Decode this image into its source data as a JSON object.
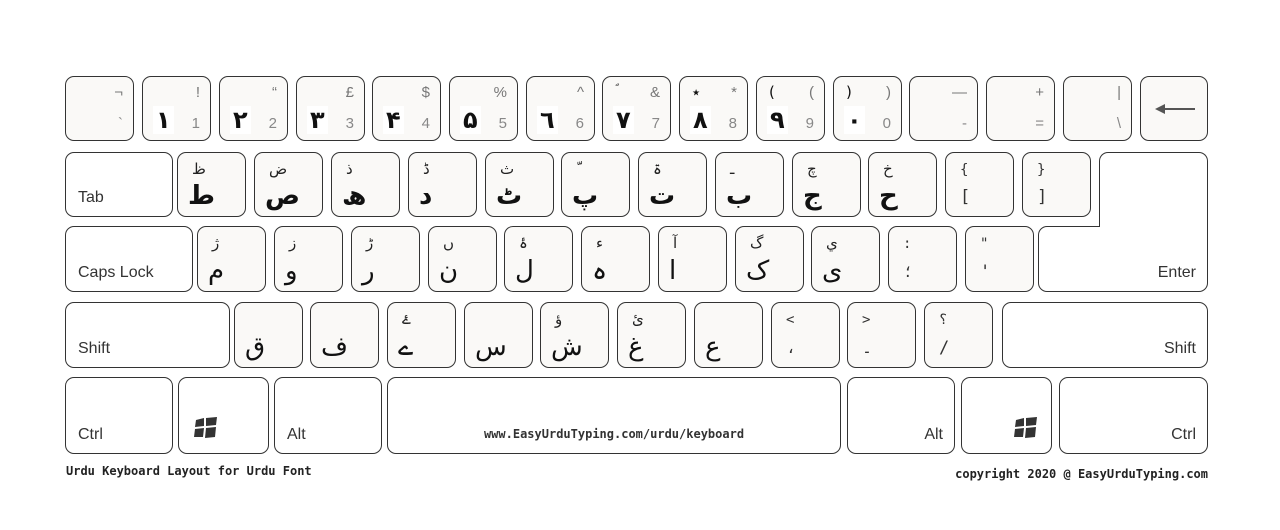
{
  "number_row": [
    {
      "shift": "¬",
      "en": "`",
      "ur": ""
    },
    {
      "shift": "!",
      "en": "1",
      "ur": "۱"
    },
    {
      "shift": "“",
      "en": "2",
      "ur": "۲"
    },
    {
      "shift": "£",
      "en": "3",
      "ur": "۳"
    },
    {
      "shift": "$",
      "en": "4",
      "ur": "۴"
    },
    {
      "shift": "%",
      "en": "5",
      "ur": "۵"
    },
    {
      "shift": "^",
      "en": "6",
      "ur": "٦"
    },
    {
      "shift": "&",
      "en": "7",
      "ur": "۷",
      "ur_shift": "ؐ"
    },
    {
      "shift": "*",
      "en": "8",
      "ur": "۸",
      "ur_shift": "٭"
    },
    {
      "shift": "(",
      "en": "9",
      "ur": "۹",
      "ur_shift": "("
    },
    {
      "shift": ")",
      "en": "0",
      "ur": "۰",
      "ur_shift": ")"
    },
    {
      "shift": "—",
      "en": "-",
      "ur": ""
    },
    {
      "shift": "+",
      "en": "=",
      "ur": ""
    },
    {
      "shift": "|",
      "en": "\\",
      "ur": ""
    }
  ],
  "backspace": {
    "icon": "backspace-arrow-icon"
  },
  "tab": {
    "label": "Tab"
  },
  "top_row": [
    {
      "top": "ظ",
      "main": "ط"
    },
    {
      "top": "ض",
      "main": "ص"
    },
    {
      "top": "ذ",
      "main": "ھ"
    },
    {
      "top": "ڈ",
      "main": "د"
    },
    {
      "top": "ث",
      "main": "ٹ"
    },
    {
      "top": "ّ",
      "main": "پ"
    },
    {
      "top": "ۃ",
      "main": "ت"
    },
    {
      "top": "ـ",
      "main": "ب"
    },
    {
      "top": "چ",
      "main": "ج"
    },
    {
      "top": "خ",
      "main": "ح"
    },
    {
      "top": "{",
      "main": "["
    },
    {
      "top": "}",
      "main": "]"
    }
  ],
  "caps": {
    "label": "Caps Lock"
  },
  "home_row": [
    {
      "top": "ژ",
      "main": "م"
    },
    {
      "top": "ز",
      "main": "و"
    },
    {
      "top": "ڑ",
      "main": "ر"
    },
    {
      "top": "ں",
      "main": "ن"
    },
    {
      "top": "ۂ",
      "main": "ل"
    },
    {
      "top": "ء",
      "main": "ہ"
    },
    {
      "top": "آ",
      "main": "ا"
    },
    {
      "top": "گ",
      "main": "ک"
    },
    {
      "top": "ي",
      "main": "ی"
    },
    {
      "top": ":",
      "main": "؛"
    },
    {
      "top": "\"",
      "main": "'"
    }
  ],
  "enter": {
    "label": "Enter"
  },
  "shift_left": {
    "label": "Shift"
  },
  "bottom_row": [
    {
      "top": "",
      "main": "ق"
    },
    {
      "top": "",
      "main": "ف"
    },
    {
      "top": "ۓ",
      "main": "ے"
    },
    {
      "top": "",
      "main": "س"
    },
    {
      "top": "ؤ",
      "main": "ش"
    },
    {
      "top": "ئ",
      "main": "غ"
    },
    {
      "top": "",
      "main": "ع"
    },
    {
      "top": "<",
      "main": "،"
    },
    {
      "top": ">",
      "main": "۔"
    },
    {
      "top": "؟",
      "main": "/"
    }
  ],
  "shift_right": {
    "label": "Shift"
  },
  "ctrl_left": {
    "label": "Ctrl"
  },
  "alt_left": {
    "label": "Alt"
  },
  "space": {
    "label": "www.EasyUrduTyping.com/urdu/keyboard"
  },
  "alt_right": {
    "label": "Alt"
  },
  "ctrl_right": {
    "label": "Ctrl"
  },
  "footer": {
    "left": "Urdu Keyboard Layout for Urdu Font",
    "right": "copyright 2020 @ EasyUrduTyping.com"
  }
}
